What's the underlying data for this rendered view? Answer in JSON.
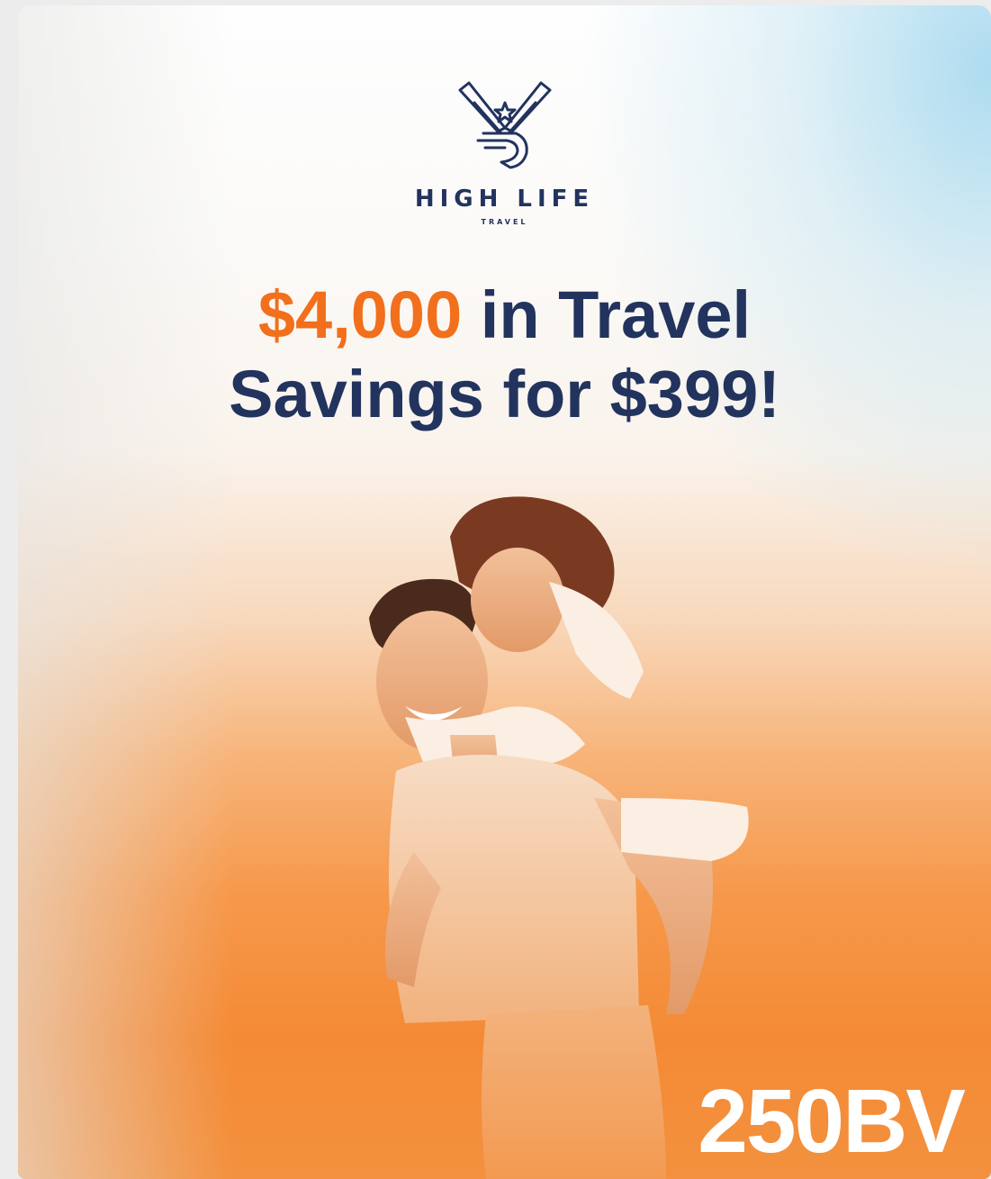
{
  "brand": {
    "name": "HIGH LIFE",
    "subtitle": "TRAVEL",
    "logo_icon": "eagle-wing-icon",
    "color": "#22335e"
  },
  "headline": {
    "amount": "$4,000",
    "line1_rest": " in Travel",
    "line2": "Savings for $399!",
    "amount_color": "#f26f1c",
    "text_color": "#22335e"
  },
  "badge": {
    "value": "250BV"
  },
  "photo": {
    "subject": "couple-piggyback-beach-photo"
  }
}
